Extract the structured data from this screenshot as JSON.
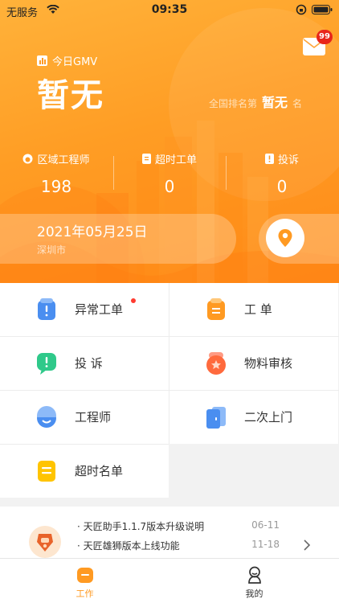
{
  "status_bar": {
    "carrier": "无服务",
    "time": "09:35"
  },
  "header": {
    "mail_badge": "99",
    "gmv_label": "今日GMV",
    "gmv_value": "暂无",
    "rank_prefix": "全国排名第",
    "rank_value": "暂无",
    "rank_suffix": "名"
  },
  "stats": [
    {
      "label": "区域工程师",
      "value": "198",
      "icon": "engineer-icon"
    },
    {
      "label": "超时工单",
      "value": "0",
      "icon": "ticket-icon"
    },
    {
      "label": "投诉",
      "value": "0",
      "icon": "complaint-icon"
    }
  ],
  "location": {
    "date": "2021年05月25日",
    "city": "深圳市",
    "icon": "location-pin-icon"
  },
  "menu": [
    {
      "label": "异常工单",
      "icon": "abnormal-ticket-icon",
      "has_dot": true
    },
    {
      "label": "工 单",
      "icon": "work-order-icon",
      "has_dot": false
    },
    {
      "label": "投 诉",
      "icon": "complaint-bubble-icon",
      "has_dot": false
    },
    {
      "label": "物料审核",
      "icon": "material-audit-icon",
      "has_dot": false
    },
    {
      "label": "工程师",
      "icon": "engineer-avatar-icon",
      "has_dot": false
    },
    {
      "label": "二次上门",
      "icon": "revisit-door-icon",
      "has_dot": false
    },
    {
      "label": "超时名单",
      "icon": "timeout-list-icon",
      "has_dot": false
    }
  ],
  "notices": [
    {
      "title": "· 天匠助手1.1.7版本升级说明",
      "date": "06-11"
    },
    {
      "title": "· 天匠雄狮版本上线功能",
      "date": "11-18"
    }
  ],
  "tabbar": {
    "tabs": [
      {
        "label": "工作",
        "icon": "briefcase-icon",
        "active": true
      },
      {
        "label": "我的",
        "icon": "profile-icon",
        "active": false
      }
    ]
  },
  "colors": {
    "accent": "#ff9a22",
    "badge": "#e8261a",
    "dot": "#ff3b30",
    "active_tab": "#ff9a22",
    "inactive_tab": "#333333"
  }
}
